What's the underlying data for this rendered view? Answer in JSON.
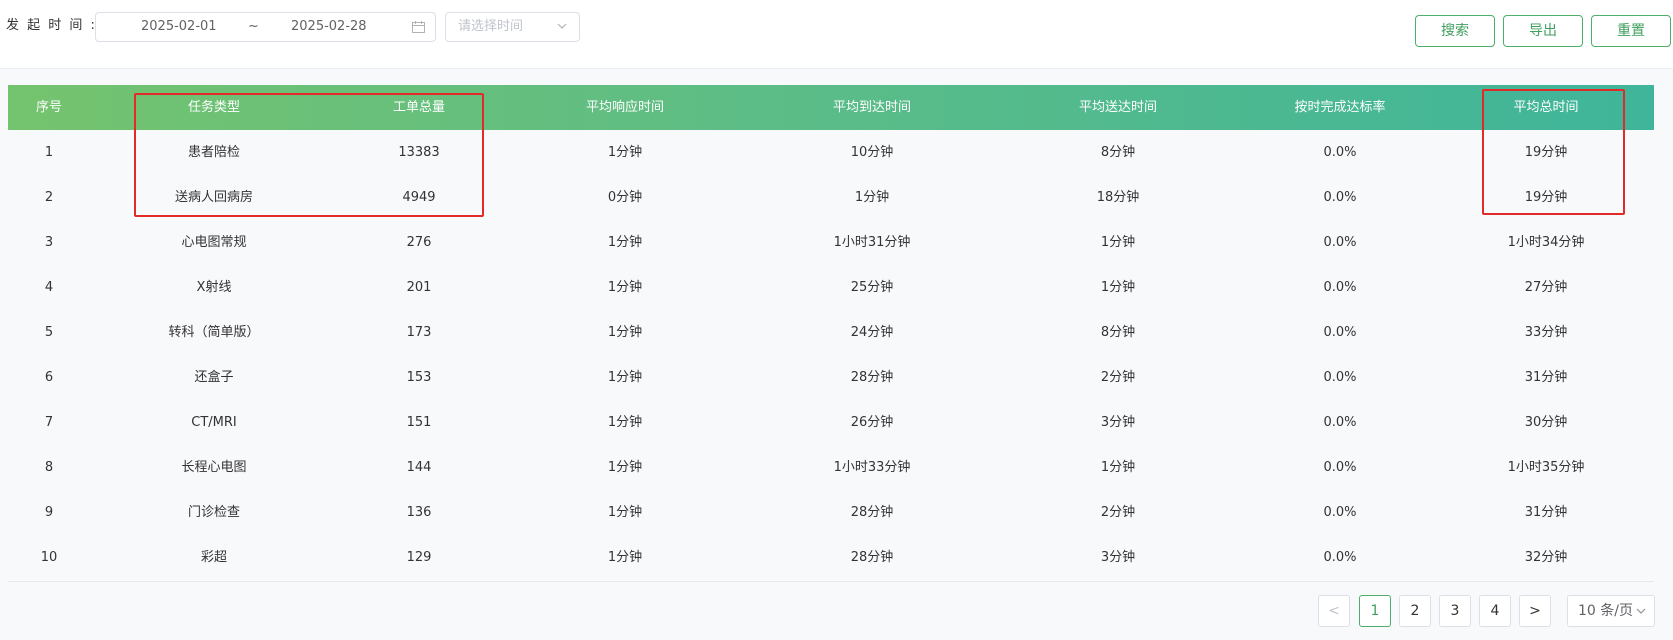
{
  "filters": {
    "label": "发 起 时 间 :",
    "date_start": "2025-02-01",
    "date_separator": "~",
    "date_end": "2025-02-28",
    "time_select_placeholder": "请选择时间"
  },
  "actions": {
    "search": "搜索",
    "export": "导出",
    "reset": "重置"
  },
  "table": {
    "columns": [
      "序号",
      "任务类型",
      "工单总量",
      "平均响应时间",
      "平均到达时间",
      "平均送达时间",
      "按时完成达标率",
      "平均总时间"
    ],
    "rows": [
      [
        "1",
        "患者陪检",
        "13383",
        "1分钟",
        "10分钟",
        "8分钟",
        "0.0%",
        "19分钟"
      ],
      [
        "2",
        "送病人回病房",
        "4949",
        "0分钟",
        "1分钟",
        "18分钟",
        "0.0%",
        "19分钟"
      ],
      [
        "3",
        "心电图常规",
        "276",
        "1分钟",
        "1小时31分钟",
        "1分钟",
        "0.0%",
        "1小时34分钟"
      ],
      [
        "4",
        "X射线",
        "201",
        "1分钟",
        "25分钟",
        "1分钟",
        "0.0%",
        "27分钟"
      ],
      [
        "5",
        "转科（简单版）",
        "173",
        "1分钟",
        "24分钟",
        "8分钟",
        "0.0%",
        "33分钟"
      ],
      [
        "6",
        "还盒子",
        "153",
        "1分钟",
        "28分钟",
        "2分钟",
        "0.0%",
        "31分钟"
      ],
      [
        "7",
        "CT/MRI",
        "151",
        "1分钟",
        "26分钟",
        "3分钟",
        "0.0%",
        "30分钟"
      ],
      [
        "8",
        "长程心电图",
        "144",
        "1分钟",
        "1小时33分钟",
        "1分钟",
        "0.0%",
        "1小时35分钟"
      ],
      [
        "9",
        "门诊检查",
        "136",
        "1分钟",
        "28分钟",
        "2分钟",
        "0.0%",
        "31分钟"
      ],
      [
        "10",
        "彩超",
        "129",
        "1分钟",
        "28分钟",
        "3分钟",
        "0.0%",
        "32分钟"
      ]
    ]
  },
  "pagination": {
    "prev": "<",
    "pages": [
      "1",
      "2",
      "3",
      "4"
    ],
    "current": "1",
    "next": ">",
    "page_size": "10 条/页"
  },
  "colors": {
    "accent": "#4caf6a",
    "header_gradient_start": "#74c36e",
    "header_gradient_end": "#3fb59a",
    "highlight": "#e32a2a"
  }
}
